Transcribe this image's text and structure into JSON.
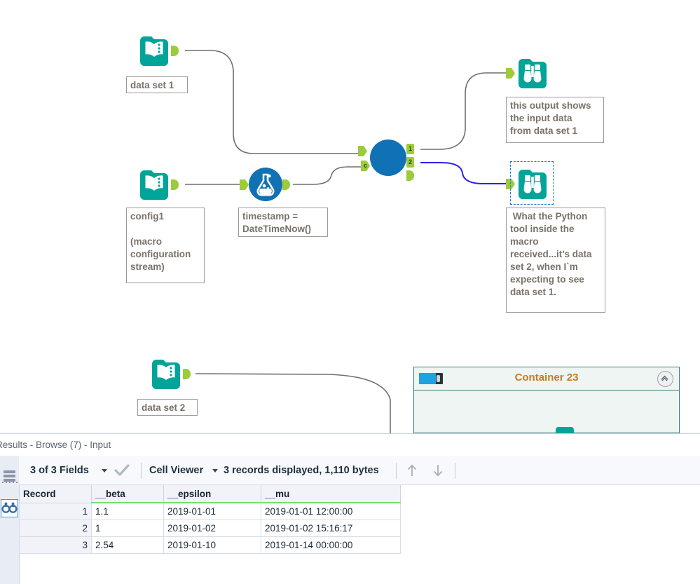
{
  "canvas": {
    "tools": [
      {
        "id": "input-dataset1",
        "icon": "input-data-icon",
        "label": "data set 1"
      },
      {
        "id": "input-config1",
        "icon": "input-data-icon",
        "label": "config1\n\n(macro\nconfiguration\nstream)"
      },
      {
        "id": "formula-timestamp",
        "icon": "formula-flask-icon",
        "label": "timestamp =\nDateTimeNow()"
      },
      {
        "id": "macro-tool",
        "icon": "macro-circle-icon",
        "label": ""
      },
      {
        "id": "browse-top",
        "icon": "browse-binoculars-icon",
        "label": "this output shows\nthe input data\nfrom data set 1"
      },
      {
        "id": "browse-bottom",
        "icon": "browse-binoculars-icon",
        "label": " What the Python\ntool inside the\nmacro\nreceived...it's data\nset 2, when I`m\nexpecting to see\ndata set 1."
      },
      {
        "id": "input-dataset2",
        "icon": "input-data-icon",
        "label": "data set 2"
      }
    ],
    "macro_anchors": {
      "inputs": [
        "",
        "c"
      ],
      "outputs": [
        "1",
        "2",
        ""
      ]
    },
    "container": {
      "title": "Container 23",
      "toggle_icon": "disable-toggle-icon",
      "collapse_icon": "collapse-chevron-icon"
    },
    "colors": {
      "tool_teal": "#00a499",
      "tool_blue": "#1071b5",
      "anchor_green": "#9ccb3b",
      "wire_gray": "#6f6f6f",
      "wire_blue": "#2a24e8",
      "selection_blue": "#1f72df",
      "annotation_text": "#7a7268",
      "container_border": "#3d7c79",
      "container_fill": "#eef5f3",
      "container_title": "#c97b20"
    }
  },
  "results": {
    "title": "Results - Browse (7) - Input",
    "rail": {
      "messages_icon": "messages-list-icon",
      "browse_icon": "browse-binoculars-icon"
    },
    "toolbar": {
      "fields_label": "3 of 3 Fields",
      "fields_caret_icon": "chevron-down-icon",
      "check_icon": "checkmark-icon",
      "viewer_label": "Cell Viewer",
      "viewer_caret_icon": "chevron-down-icon",
      "record_count_label": "3 records displayed, 1,110 bytes",
      "up_arrow_icon": "arrow-up-icon",
      "down_arrow_icon": "arrow-down-icon"
    },
    "grid": {
      "columns": [
        "Record",
        "__beta",
        "__epsilon",
        "__mu"
      ],
      "rows": [
        {
          "record": "1",
          "beta": "1.1",
          "epsilon": "2019-01-01",
          "mu": "2019-01-01 12:00:00"
        },
        {
          "record": "2",
          "beta": "1",
          "epsilon": "2019-01-02",
          "mu": "2019-01-02 15:16:17"
        },
        {
          "record": "3",
          "beta": "2.54",
          "epsilon": "2019-01-10",
          "mu": "2019-01-14 00:00:00"
        }
      ]
    }
  }
}
